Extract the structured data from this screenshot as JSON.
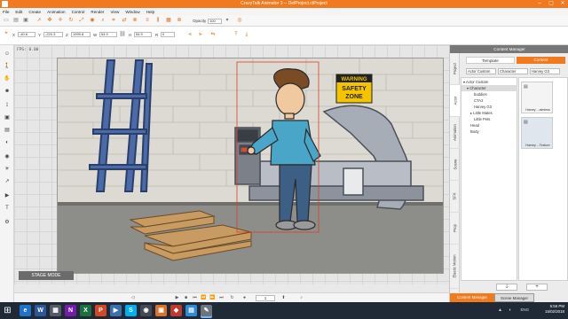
{
  "window": {
    "title": "CrazyTalk Animator 3 -- DefProject.ctProject"
  },
  "menu": [
    "File",
    "Edit",
    "Create",
    "Animation",
    "Control",
    "Render",
    "View",
    "Window",
    "Help"
  ],
  "toolbar": {
    "opacity_label": "Opacity",
    "opacity_value": "100",
    "x_label": "X",
    "x_value": "-40.6",
    "y_label": "Y",
    "y_value": "-220.3",
    "z_label": "Z",
    "z_value": "1999.8",
    "w_label": "W",
    "w_value": "54.9",
    "h_label": "H",
    "h_value": "54.9",
    "r_label": "R",
    "r_value": "0"
  },
  "stage": {
    "fps_label": "FPS: 0.00",
    "mode_label": "STAGE MODE",
    "sign": {
      "line1": "WARNING",
      "line2": "SAFETY",
      "line3": "ZONE"
    }
  },
  "timeline": {
    "frame_value": "1"
  },
  "content_manager": {
    "title": "Content Manager",
    "tabs": {
      "template": "Template",
      "content": "Content"
    },
    "side_tabs": [
      "Project",
      "Actor",
      "Animation",
      "Scene",
      "SFX",
      "Prop",
      "Elastic Motion"
    ],
    "path": {
      "root": "Actor Custom",
      "cat": "Character",
      "item": "Harvey G3"
    },
    "tree": [
      {
        "label": "Actor Custom",
        "indent": 1,
        "arrow": "▾"
      },
      {
        "label": "Character",
        "indent": 2,
        "arrow": "▾",
        "selected": true
      },
      {
        "label": "buddies",
        "indent": 3,
        "arrow": ""
      },
      {
        "label": "CTA2",
        "indent": 3,
        "arrow": ""
      },
      {
        "label": "Harvey G3",
        "indent": 3,
        "arrow": ""
      },
      {
        "label": "Little Mates",
        "indent": 3,
        "arrow": "▸"
      },
      {
        "label": "Little Pets",
        "indent": 3,
        "arrow": ""
      },
      {
        "label": "Head",
        "indent": 2,
        "arrow": ""
      },
      {
        "label": "Body",
        "indent": 2,
        "arrow": ""
      }
    ],
    "thumbs": [
      {
        "caption": "Harvey ...aimless"
      },
      {
        "caption": "Harvey ...Texture"
      }
    ],
    "footer": {
      "remove": "🡓",
      "add": "+"
    },
    "managers": {
      "content": "Content Manager",
      "scene": "Scene Manager"
    }
  },
  "taskbar": {
    "time": "5:56 PM",
    "date": "15/02/2018",
    "lang": "ENG",
    "apps": [
      {
        "label": "e",
        "color": "#1e73c8"
      },
      {
        "label": "W",
        "color": "#2b579a"
      },
      {
        "label": "▦",
        "color": "#555b66"
      },
      {
        "label": "N",
        "color": "#7719aa"
      },
      {
        "label": "X",
        "color": "#1d6f42"
      },
      {
        "label": "P",
        "color": "#d24726"
      },
      {
        "label": "▶",
        "color": "#3a6fb0"
      },
      {
        "label": "S",
        "color": "#00aff0"
      },
      {
        "label": "◉",
        "color": "#444a55"
      },
      {
        "label": "▣",
        "color": "#d9732b"
      },
      {
        "label": "◆",
        "color": "#c0392b"
      },
      {
        "label": "▤",
        "color": "#2e8bd8"
      },
      {
        "label": "✎",
        "color": "#6c757d"
      }
    ]
  },
  "colors": {
    "accent": "#f07a1d",
    "taskbar": "#1f2a36"
  }
}
